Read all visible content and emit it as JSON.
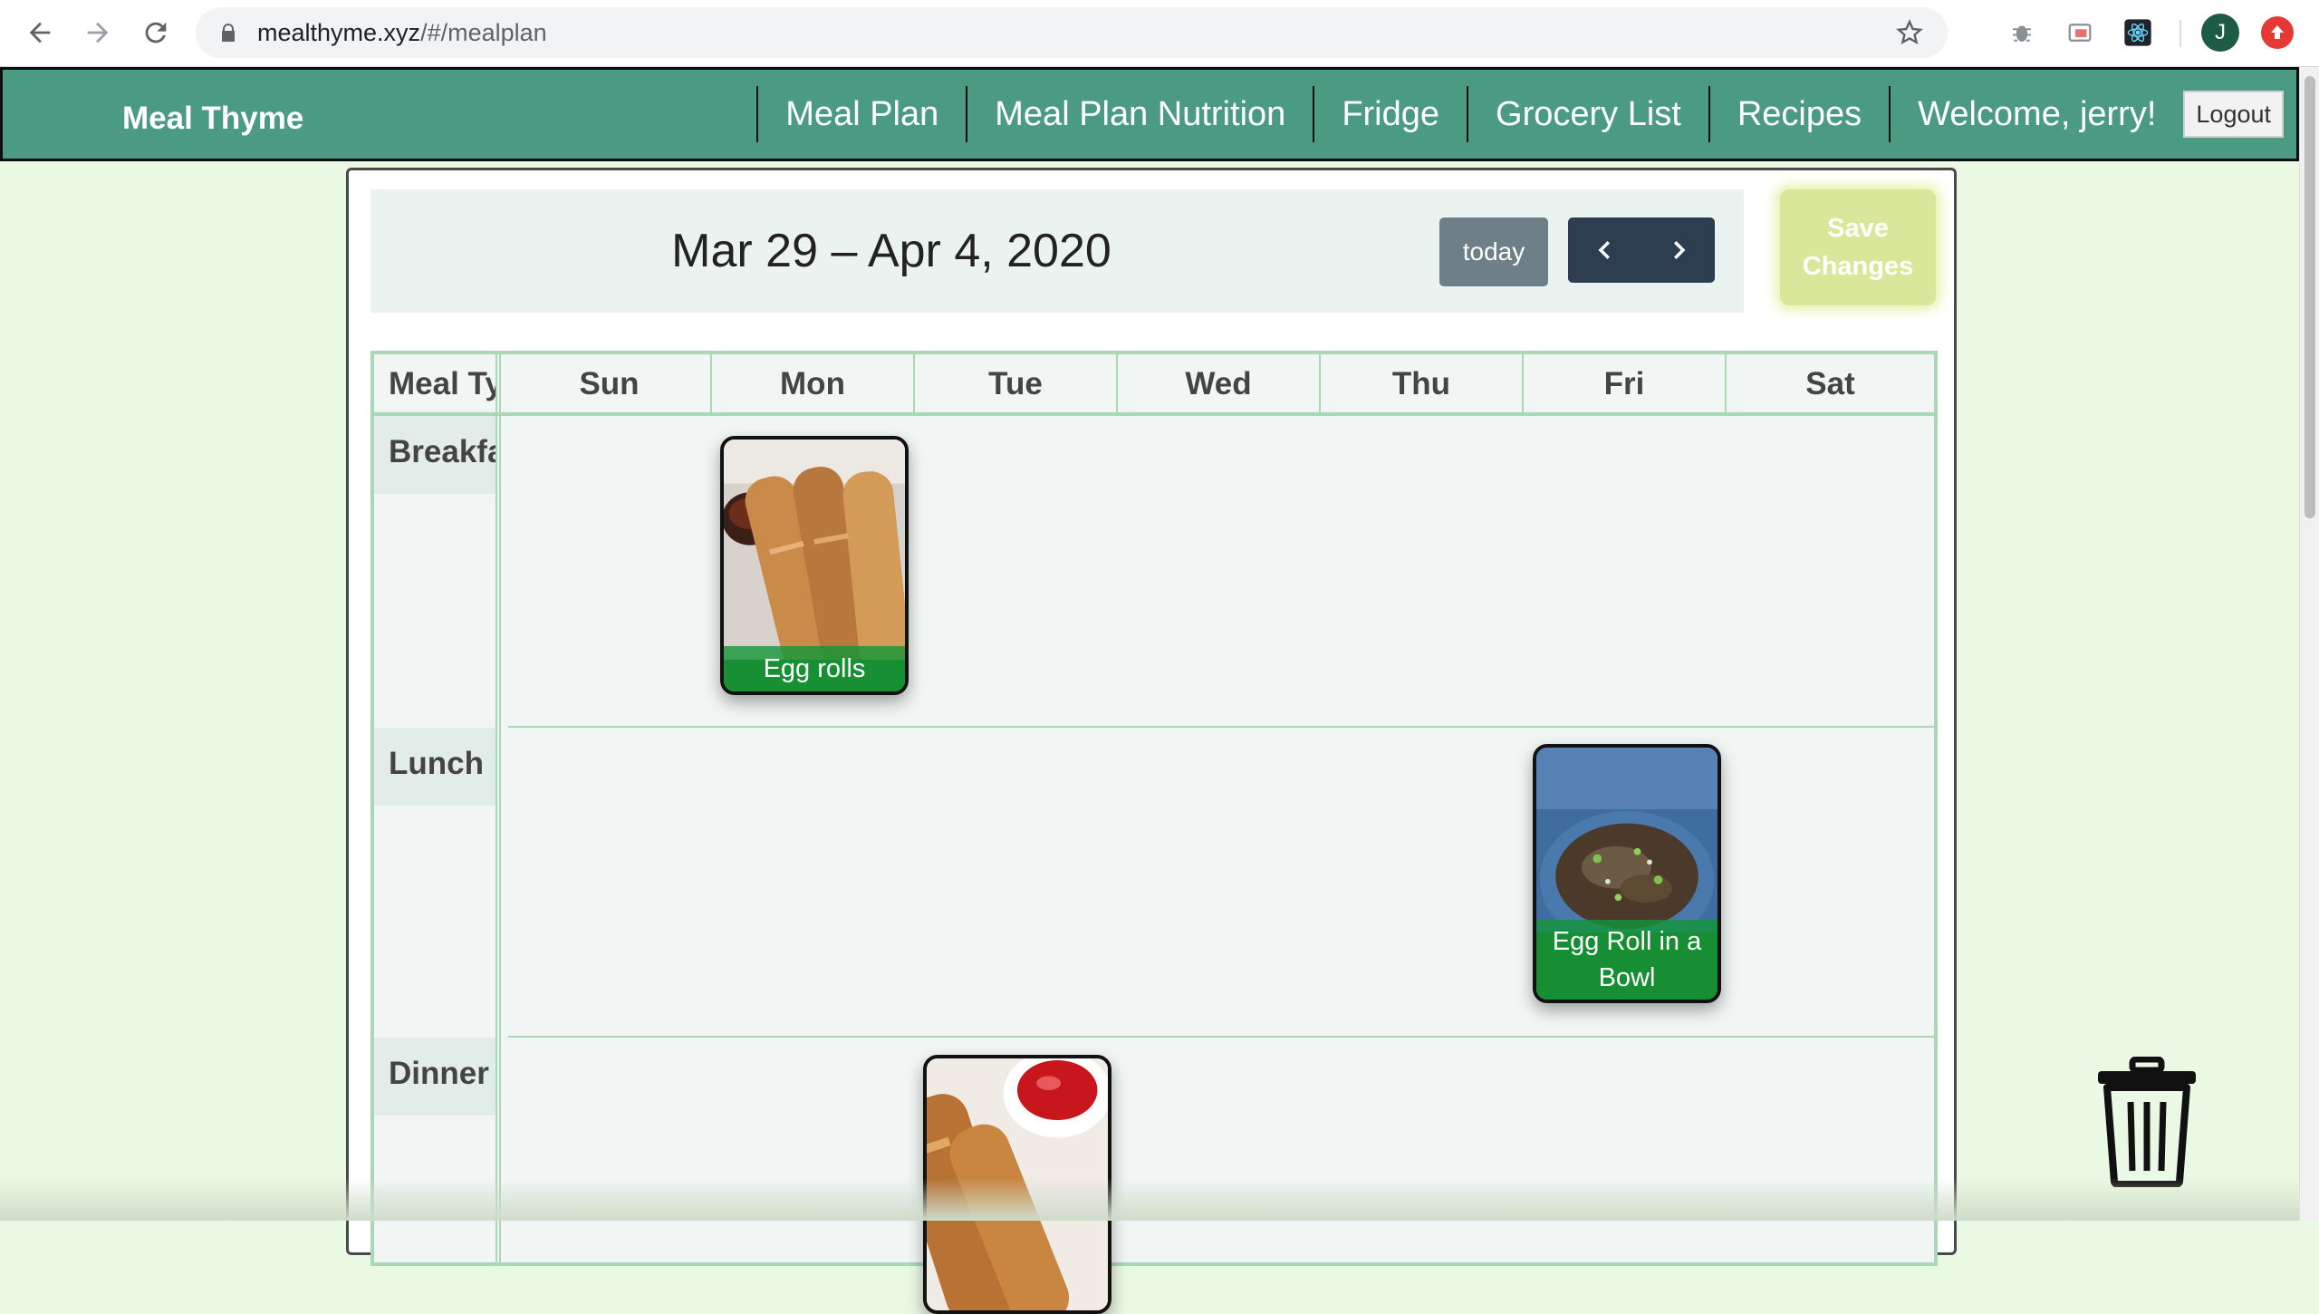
{
  "browser": {
    "url_host": "mealthyme.xyz",
    "url_path": "/#/mealplan",
    "profile_initial": "J"
  },
  "nav": {
    "brand": "Meal Thyme",
    "links": [
      "Meal Plan",
      "Meal Plan Nutrition",
      "Fridge",
      "Grocery List",
      "Recipes"
    ],
    "welcome": "Welcome, jerry!",
    "logout": "Logout"
  },
  "calendar": {
    "range_title": "Mar 29 – Apr 4, 2020",
    "today_label": "today",
    "save_label_line1": "Save",
    "save_label_line2": "Changes",
    "meal_type_header": "Meal Type",
    "days": [
      "Sun",
      "Mon",
      "Tue",
      "Wed",
      "Thu",
      "Fri",
      "Sat"
    ],
    "rows": [
      "Breakfast",
      "Lunch",
      "Dinner"
    ],
    "meals": [
      {
        "name": "Egg rolls",
        "day": "Mon",
        "meal": "Breakfast"
      },
      {
        "name": "Egg Roll in a Bowl",
        "day": "Fri",
        "meal": "Lunch"
      },
      {
        "name": "",
        "day": "Tue",
        "meal": "Dinner"
      }
    ]
  },
  "colors": {
    "navbar": "#4b9a82",
    "page_bg": "#eaf9e3",
    "grid_border": "#a9d8b6",
    "save_button": "#d8e79a",
    "nav_group": "#2c3e50",
    "today_button": "#6e7f87"
  },
  "icons": [
    "back-icon",
    "forward-icon",
    "reload-icon",
    "lock-icon",
    "star-icon",
    "chevron-left-icon",
    "chevron-right-icon",
    "trash-icon"
  ]
}
